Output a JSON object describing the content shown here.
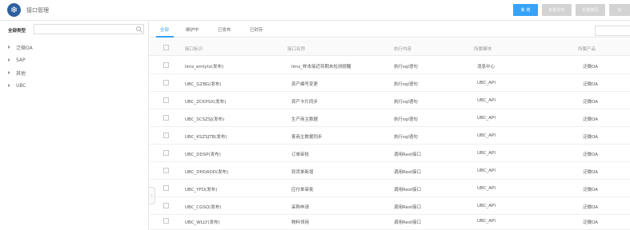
{
  "header": {
    "logo": "gear-icon",
    "title": "接口管理",
    "btn_new": "新 增",
    "btn_b1": "批量发布",
    "btn_b2": "批量撤回",
    "btn_b3": "批"
  },
  "sidebar": {
    "title": "全部类型",
    "search_placeholder": "",
    "tree": [
      {
        "label": "泛微OA"
      },
      {
        "label": "SAP"
      },
      {
        "label": "其他"
      },
      {
        "label": "UBC"
      }
    ]
  },
  "tabs": [
    {
      "label": "全部"
    },
    {
      "label": "维护中"
    },
    {
      "label": "已发布"
    },
    {
      "label": "已封存"
    }
  ],
  "table": {
    "columns": [
      "接口标识",
      "接口名称",
      "执行内容",
      "所属模块",
      "所属产品"
    ],
    "rows": [
      [
        "lims_emlytx(发布)",
        "lims_样本接近到期未检测提醒",
        "执行sql语句",
        "消息中心",
        "泛微OA"
      ],
      [
        "UBC_GZBG(发布)",
        "资产编号变更",
        "执行sql语句",
        "UBC_API",
        "泛微OA"
      ],
      [
        "UBC_ZCKPSX(发布)",
        "资产卡片同步",
        "执行sql语句",
        "UBC_API",
        "泛微OA"
      ],
      [
        "UBC_SCSZSJ(发布)",
        "生产商主数据",
        "执行sql语句",
        "UBC_API",
        "泛微OA"
      ],
      [
        "UBC_KSZSJTB(发布)",
        "客商主数据同步",
        "执行sql语句",
        "UBC_API",
        "泛微OA"
      ],
      [
        "UBC_DDSP(发布)",
        "订单审批",
        "调用Rest接口",
        "UBC_API",
        "泛微OA"
      ],
      [
        "UBC_DHDADD(发布)",
        "到货单新增",
        "调用Rest接口",
        "UBC_API",
        "泛微OA"
      ],
      [
        "UBC_YFD(发布)",
        "应付单审批",
        "调用Rest接口",
        "UBC_API",
        "泛微OA"
      ],
      [
        "UBC_CGSQ(发布)",
        "采购申请",
        "调用Rest接口",
        "UBC_API",
        "泛微OA"
      ],
      [
        "UBC_WLLY(发布)",
        "物料领用",
        "调用Rest接口",
        "UBC_API",
        "泛微OA"
      ]
    ]
  }
}
